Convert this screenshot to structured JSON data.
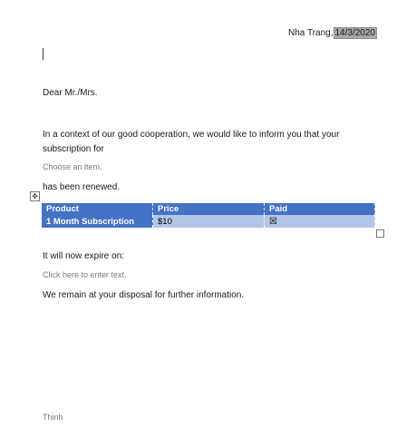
{
  "header": {
    "location": "Nha Trang,",
    "date": "14/3/2020"
  },
  "letter": {
    "greeting": "Dear Mr./Mrs.",
    "intro": "In a context of our good cooperation, we would like to inform you that your subscription for",
    "item_placeholder": "Choose an item.",
    "renewed": "has been renewed.",
    "expire_label": "It will now expire on:",
    "date_placeholder": "Click here to enter text.",
    "closing": "We remain at your disposal for further information.",
    "signer": "Thinh"
  },
  "table": {
    "headers": [
      "Product",
      "Price",
      "Paid"
    ],
    "row": {
      "product": "1 Month Subscription",
      "price": "$10",
      "paid_glyph": "☒"
    }
  },
  "icons": {
    "move_handle": "move-icon",
    "resize_handle": "resize-icon"
  },
  "colors": {
    "header_fill": "#4472c4",
    "row_fill": "#b4c6e7",
    "field_highlight": "#a8a8a8"
  }
}
